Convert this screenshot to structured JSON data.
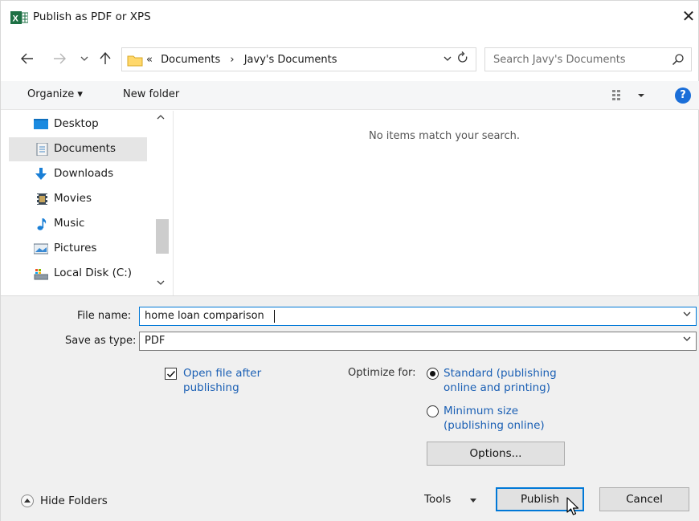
{
  "window": {
    "title": "Publish as PDF or XPS",
    "close_glyph": "✕"
  },
  "address_bar": {
    "prefix": "«",
    "crumbs": [
      "Documents",
      "Javy's Documents"
    ],
    "separator": "›",
    "search_placeholder": "Search Javy's Documents"
  },
  "toolbar": {
    "organize_label": "Organize ▾",
    "new_folder_label": "New folder",
    "help_glyph": "?"
  },
  "nav_pane": {
    "items": [
      {
        "label": "Desktop",
        "icon": "desktop-icon"
      },
      {
        "label": "Documents",
        "icon": "documents-icon",
        "selected": true
      },
      {
        "label": "Downloads",
        "icon": "downloads-icon"
      },
      {
        "label": "Movies",
        "icon": "movies-icon"
      },
      {
        "label": "Music",
        "icon": "music-icon"
      },
      {
        "label": "Pictures",
        "icon": "pictures-icon"
      },
      {
        "label": "Local Disk (C:)",
        "icon": "local-disk-icon"
      }
    ]
  },
  "content": {
    "empty_message": "No items match your search."
  },
  "form": {
    "file_name_label": "File name:",
    "file_name_value": "home loan comparison",
    "save_type_label": "Save as type:",
    "save_type_value": "PDF",
    "open_after_label": "Open file after publishing",
    "open_after_checked": true,
    "optimize_label": "Optimize for:",
    "optimize_options": [
      {
        "label": "Standard (publishing online and printing)",
        "selected": true
      },
      {
        "label": "Minimum size (publishing online)",
        "selected": false
      }
    ],
    "options_button": "Options..."
  },
  "footer": {
    "hide_folders_label": "Hide Folders",
    "tools_label": "Tools",
    "publish_label": "Publish",
    "cancel_label": "Cancel"
  },
  "colors": {
    "accent": "#0078d7",
    "link": "#1a5fb4",
    "excel_green": "#1d7044",
    "help_blue": "#1a6ed8"
  }
}
